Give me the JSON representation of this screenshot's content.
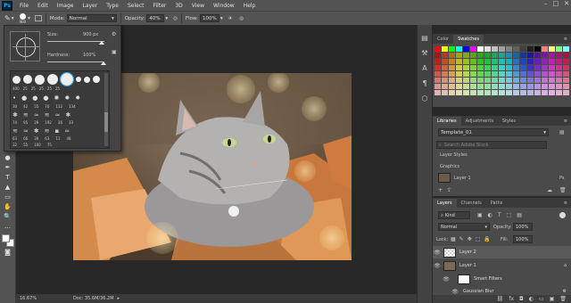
{
  "app": {
    "logo": "Ps"
  },
  "menu": [
    "File",
    "Edit",
    "Image",
    "Layer",
    "Type",
    "Select",
    "Filter",
    "3D",
    "View",
    "Window",
    "Help"
  ],
  "options": {
    "brush_size": "900",
    "mode_label": "Mode:",
    "mode_value": "Normal",
    "opacity_label": "Opacity:",
    "opacity_value": "40%",
    "flow_label": "Flow:",
    "flow_value": "100%"
  },
  "brush_panel": {
    "size_label": "Size:",
    "size_value": "900 px",
    "hardness_label": "Hardness:",
    "hardness_value": "100%",
    "presets": [
      "400",
      "25",
      "25",
      "25",
      "25",
      "25",
      "30",
      "42",
      "55",
      "70",
      "112",
      "134",
      "74",
      "95",
      "29",
      "192",
      "36",
      "33",
      "63",
      "66",
      "39",
      "63",
      "11",
      "48",
      "32",
      "55",
      "100",
      "75"
    ]
  },
  "status": {
    "zoom": "16.67%",
    "doc": "Doc: 35.6M/36.2M"
  },
  "color_panel": {
    "tabs": [
      "Color",
      "Swatches"
    ]
  },
  "libraries_panel": {
    "tabs": [
      "Libraries",
      "Adjustments",
      "Styles"
    ],
    "library": "Template_01",
    "search_placeholder": "Search Adobe Stock",
    "section1": "Layer Styles",
    "section2": "Graphics",
    "graphic_item": "Layer 1"
  },
  "layers_panel": {
    "tabs": [
      "Layers",
      "Channels",
      "Paths"
    ],
    "filter_label": "Kind",
    "blend_mode": "Normal",
    "opacity_label": "Opacity:",
    "opacity_value": "100%",
    "lock_label": "Lock:",
    "fill_label": "Fill:",
    "fill_value": "100%",
    "layers": [
      {
        "name": "Layer 2"
      },
      {
        "name": "Layer 1"
      },
      {
        "name": "Smart Filters"
      },
      {
        "name": "Gaussian Blur"
      }
    ]
  },
  "colors": {
    "accent": "#31a8ff"
  }
}
